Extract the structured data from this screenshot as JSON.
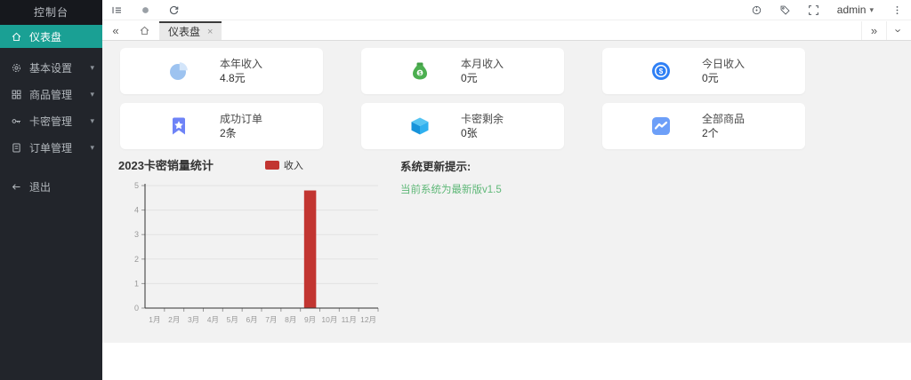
{
  "sidebar": {
    "title": "控制台",
    "active_color": "#1aa094",
    "active_item": {
      "label": "仪表盘"
    },
    "items": [
      {
        "label": "基本设置"
      },
      {
        "label": "商品管理"
      },
      {
        "label": "卡密管理"
      },
      {
        "label": "订单管理"
      }
    ],
    "logout_label": "退出"
  },
  "toolbar": {
    "user": "admin"
  },
  "tabs": {
    "active_label": "仪表盘"
  },
  "icons": {
    "caret_down": "▾",
    "chevron_double_left": "«",
    "chevron_double_right": "»",
    "close": "×"
  },
  "stats": {
    "cards": [
      {
        "icon": "pie-chart",
        "title": "本年收入",
        "value": "4.8元"
      },
      {
        "icon": "money-bag",
        "title": "本月收入",
        "value": "0元"
      },
      {
        "icon": "coin",
        "title": "今日收入",
        "value": "0元"
      },
      {
        "icon": "bookmark-star",
        "title": "成功订单",
        "value": "2条"
      },
      {
        "icon": "cube",
        "title": "卡密剩余",
        "value": "0张"
      },
      {
        "icon": "trend",
        "title": "全部商品",
        "value": "2个"
      }
    ]
  },
  "notice": {
    "title": "系统更新提示:",
    "message": "当前系统为最新版v1.5",
    "message_color": "#5FB878"
  },
  "chart_data": {
    "type": "bar",
    "title": "2023卡密销量统计",
    "legend": [
      "收入"
    ],
    "legend_position": "top",
    "categories": [
      "1月",
      "2月",
      "3月",
      "4月",
      "5月",
      "6月",
      "7月",
      "8月",
      "9月",
      "10月",
      "11月",
      "12月"
    ],
    "values": [
      0,
      0,
      0,
      0,
      0,
      0,
      0,
      0,
      4.8,
      0,
      0,
      0
    ],
    "xlabel": "",
    "ylabel": "",
    "ylim": [
      0,
      5
    ],
    "ytick_step": 1,
    "grid": true,
    "bar_color": "#c23531"
  }
}
